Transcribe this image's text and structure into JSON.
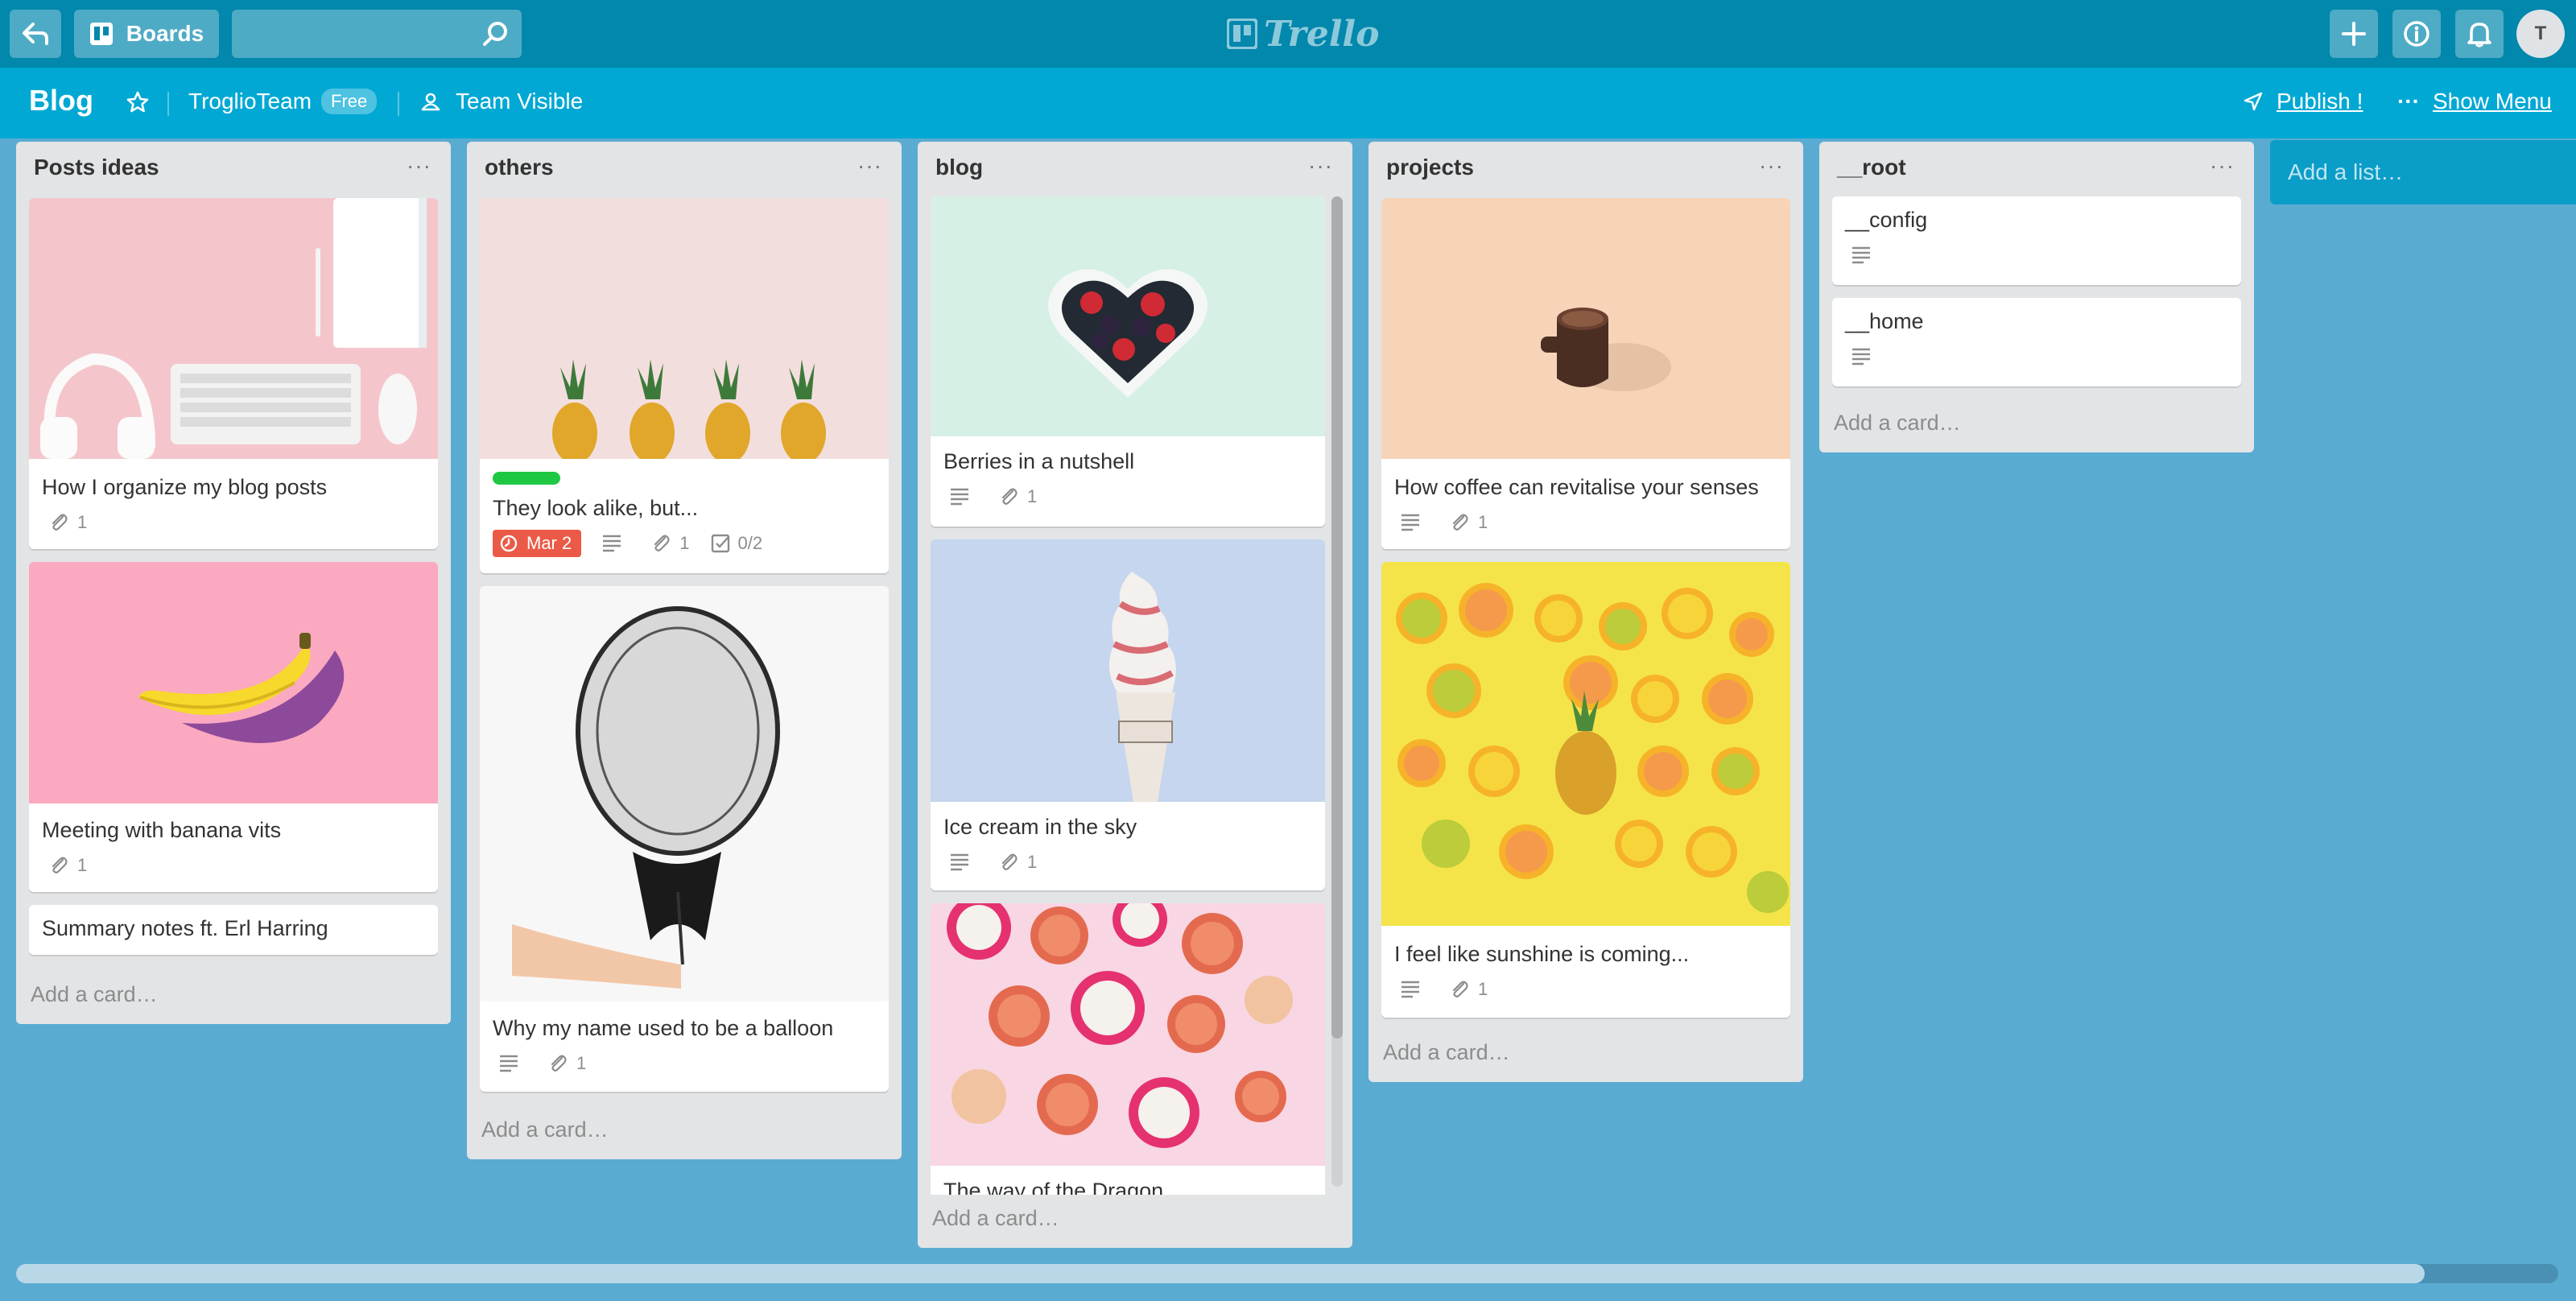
{
  "header": {
    "back_icon": "back-arrow-icon",
    "boards_label": "Boards",
    "search_value": "",
    "logo_text": "Trello",
    "avatar_initial": "T"
  },
  "board": {
    "title": "Blog",
    "team": "TroglioTeam",
    "team_badge": "Free",
    "visibility": "Team Visible",
    "publish": "Publish !",
    "show_menu": "Show Menu",
    "menu_dots": "···"
  },
  "lists": [
    {
      "title": "Posts ideas",
      "cards": [
        {
          "title": "How I organize my blog posts",
          "attachments": "1"
        },
        {
          "title": "Meeting with banana vits",
          "attachments": "1"
        },
        {
          "title": "Summary notes ft. Erl Harring"
        }
      ],
      "add_card": "Add a card…"
    },
    {
      "title": "others",
      "cards": [
        {
          "title": "They look alike, but...",
          "label_color": "#1ec843",
          "due": "Mar 2",
          "attachments": "1",
          "checklist": "0/2"
        },
        {
          "title": "Why my name used to be a balloon",
          "attachments": "1"
        }
      ],
      "add_card": "Add a card…"
    },
    {
      "title": "blog",
      "cards": [
        {
          "title": "Berries in a nutshell",
          "attachments": "1"
        },
        {
          "title": "Ice cream in the sky",
          "attachments": "1"
        },
        {
          "title": "The way of the Dragon"
        }
      ],
      "add_card": "Add a card…"
    },
    {
      "title": "projects",
      "cards": [
        {
          "title": "How coffee can revitalise your senses",
          "attachments": "1"
        },
        {
          "title": "I feel like sunshine is coming...",
          "attachments": "1"
        }
      ],
      "add_card": "Add a card…"
    },
    {
      "title": "__root",
      "cards": [
        {
          "title": "__config"
        },
        {
          "title": "__home"
        }
      ],
      "add_card": "Add a card…"
    }
  ],
  "add_list": "Add a list…",
  "colors": {
    "header": "#0287ad",
    "board_bar": "#01a8d4",
    "board_bg": "#5aabd2",
    "list_bg": "#e2e4e6",
    "due_badge": "#eb5a46",
    "label_green": "#1ec843"
  }
}
